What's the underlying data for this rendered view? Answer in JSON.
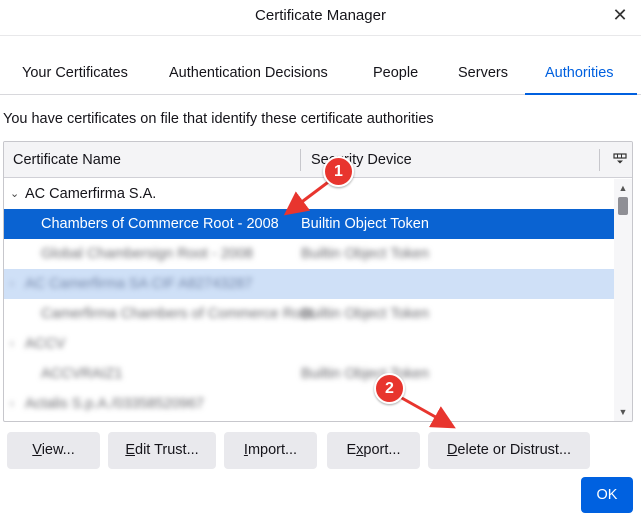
{
  "window": {
    "title": "Certificate Manager",
    "close_glyph": "✕"
  },
  "tabs": [
    {
      "label": "Your Certificates"
    },
    {
      "label": "Authentication Decisions"
    },
    {
      "label": "People"
    },
    {
      "label": "Servers"
    },
    {
      "label": "Authorities",
      "active": true
    }
  ],
  "description": "You have certificates on file that identify these certificate authorities",
  "table": {
    "columns": [
      "Certificate Name",
      "Security Device"
    ],
    "column_picker_icon": "column-picker-icon",
    "rows": [
      {
        "type": "group",
        "name": "AC Camerfirma S.A.",
        "device": "",
        "expanded": true
      },
      {
        "type": "item",
        "name": "Chambers of Commerce Root - 2008",
        "device": "Builtin Object Token",
        "selected": true
      },
      {
        "type": "item",
        "name": "Global Chambersign Root - 2008",
        "device": "Builtin Object Token",
        "blurred": true
      },
      {
        "type": "group",
        "name": "AC Camerfirma SA CIF A82743287",
        "device": "",
        "blurred": true,
        "highlighted": true
      },
      {
        "type": "item",
        "name": "Camerfirma Chambers of Commerce Root",
        "device": "Builtin Object Token",
        "blurred": true
      },
      {
        "type": "group",
        "name": "ACCV",
        "device": "",
        "blurred": true
      },
      {
        "type": "item",
        "name": "ACCVRAIZ1",
        "device": "Builtin Object Token",
        "blurred": true
      },
      {
        "type": "group",
        "name": "Actalis S.p.A./03358520967",
        "device": "",
        "blurred": true
      }
    ]
  },
  "buttons": {
    "view": {
      "accel": "V",
      "rest": "iew..."
    },
    "edit_trust": {
      "accel": "E",
      "rest": "dit Trust..."
    },
    "import": {
      "accel": "I",
      "rest": "mport..."
    },
    "export": {
      "pre": "E",
      "accel": "x",
      "rest": "port..."
    },
    "delete": {
      "accel": "D",
      "rest": "elete or Distrust..."
    },
    "ok": "OK"
  },
  "annotations": {
    "step1": "1",
    "step2": "2",
    "color": "#e8352e"
  },
  "colors": {
    "accent": "#0060df",
    "selection": "#0a63d2",
    "ok_button": "#0061e0"
  }
}
